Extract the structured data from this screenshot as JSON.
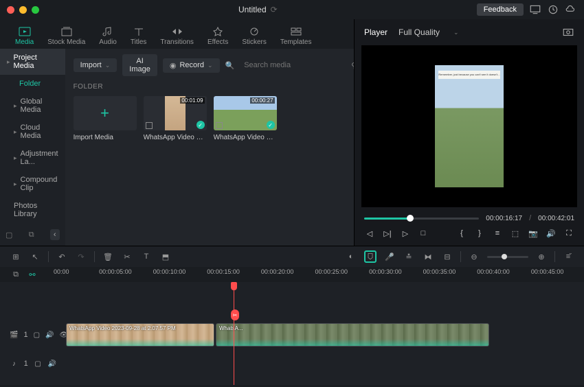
{
  "title": "Untitled",
  "feedback_label": "Feedback",
  "tabs": [
    {
      "label": "Media",
      "active": true
    },
    {
      "label": "Stock Media"
    },
    {
      "label": "Audio"
    },
    {
      "label": "Titles"
    },
    {
      "label": "Transitions"
    },
    {
      "label": "Effects"
    },
    {
      "label": "Stickers"
    },
    {
      "label": "Templates"
    }
  ],
  "sidebar": {
    "project_media": "Project Media",
    "folder": "Folder",
    "global_media": "Global Media",
    "cloud_media": "Cloud Media",
    "adjustment": "Adjustment La...",
    "compound": "Compound Clip",
    "photos": "Photos Library"
  },
  "toolbar": {
    "import": "Import",
    "ai_image": "AI Image",
    "record": "Record",
    "search_placeholder": "Search media"
  },
  "folder_label": "FOLDER",
  "thumbs": {
    "import_label": "Import Media",
    "clip1": {
      "duration": "00:01:09",
      "label": "WhatsApp Video 202..."
    },
    "clip2": {
      "duration": "00:00:27",
      "label": "WhatsApp Video 202..."
    }
  },
  "player": {
    "label": "Player",
    "quality": "Full Quality",
    "current_time": "00:00:16:17",
    "total_time": "00:00:42:01",
    "caption": "Remember, just because you can't see it doesn't..."
  },
  "ruler": [
    "00:00",
    "00:00:05:00",
    "00:00:10:00",
    "00:00:15:00",
    "00:00:20:00",
    "00:00:25:00",
    "00:00:30:00",
    "00:00:35:00",
    "00:00:40:00",
    "00:00:45:00"
  ],
  "clips": {
    "video1_label": "WhatsApp Video 2023-09-28 at 2.07.57 PM",
    "video2_label": "WhatsA..."
  },
  "track_labels": {
    "video": "1",
    "audio": "1"
  }
}
